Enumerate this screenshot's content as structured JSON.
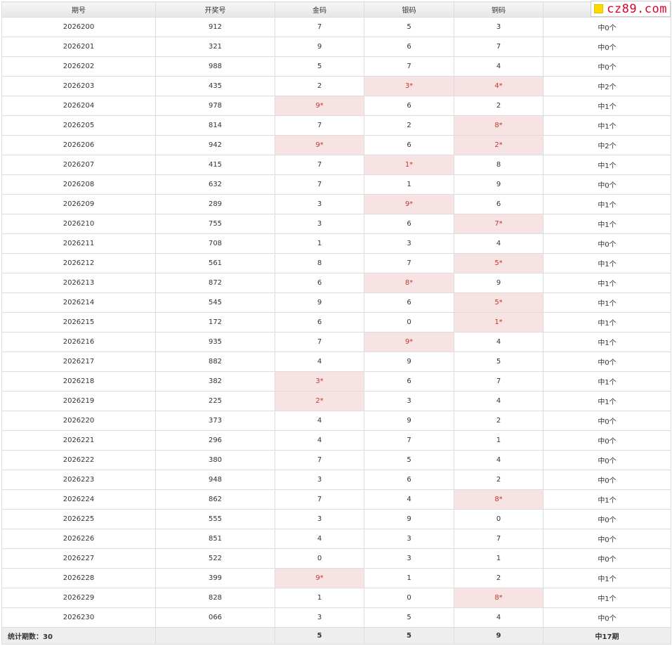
{
  "watermark": "cz89.com",
  "headers": [
    "期号",
    "开奖号",
    "金码",
    "银码",
    "铜码",
    ""
  ],
  "rows": [
    {
      "issue": "2026200",
      "number": "912",
      "gold": "7",
      "silver": "5",
      "bronze": "3",
      "result": "中0个",
      "hits": []
    },
    {
      "issue": "2026201",
      "number": "321",
      "gold": "9",
      "silver": "6",
      "bronze": "7",
      "result": "中0个",
      "hits": []
    },
    {
      "issue": "2026202",
      "number": "988",
      "gold": "5",
      "silver": "7",
      "bronze": "4",
      "result": "中0个",
      "hits": []
    },
    {
      "issue": "2026203",
      "number": "435",
      "gold": "2",
      "silver": "3*",
      "bronze": "4*",
      "result": "中2个",
      "hits": [
        "silver",
        "bronze"
      ]
    },
    {
      "issue": "2026204",
      "number": "978",
      "gold": "9*",
      "silver": "6",
      "bronze": "2",
      "result": "中1个",
      "hits": [
        "gold"
      ]
    },
    {
      "issue": "2026205",
      "number": "814",
      "gold": "7",
      "silver": "2",
      "bronze": "8*",
      "result": "中1个",
      "hits": [
        "bronze"
      ]
    },
    {
      "issue": "2026206",
      "number": "942",
      "gold": "9*",
      "silver": "6",
      "bronze": "2*",
      "result": "中2个",
      "hits": [
        "gold",
        "bronze"
      ]
    },
    {
      "issue": "2026207",
      "number": "415",
      "gold": "7",
      "silver": "1*",
      "bronze": "8",
      "result": "中1个",
      "hits": [
        "silver"
      ]
    },
    {
      "issue": "2026208",
      "number": "632",
      "gold": "7",
      "silver": "1",
      "bronze": "9",
      "result": "中0个",
      "hits": []
    },
    {
      "issue": "2026209",
      "number": "289",
      "gold": "3",
      "silver": "9*",
      "bronze": "6",
      "result": "中1个",
      "hits": [
        "silver"
      ]
    },
    {
      "issue": "2026210",
      "number": "755",
      "gold": "3",
      "silver": "6",
      "bronze": "7*",
      "result": "中1个",
      "hits": [
        "bronze"
      ]
    },
    {
      "issue": "2026211",
      "number": "708",
      "gold": "1",
      "silver": "3",
      "bronze": "4",
      "result": "中0个",
      "hits": []
    },
    {
      "issue": "2026212",
      "number": "561",
      "gold": "8",
      "silver": "7",
      "bronze": "5*",
      "result": "中1个",
      "hits": [
        "bronze"
      ]
    },
    {
      "issue": "2026213",
      "number": "872",
      "gold": "6",
      "silver": "8*",
      "bronze": "9",
      "result": "中1个",
      "hits": [
        "silver"
      ]
    },
    {
      "issue": "2026214",
      "number": "545",
      "gold": "9",
      "silver": "6",
      "bronze": "5*",
      "result": "中1个",
      "hits": [
        "bronze"
      ]
    },
    {
      "issue": "2026215",
      "number": "172",
      "gold": "6",
      "silver": "0",
      "bronze": "1*",
      "result": "中1个",
      "hits": [
        "bronze"
      ]
    },
    {
      "issue": "2026216",
      "number": "935",
      "gold": "7",
      "silver": "9*",
      "bronze": "4",
      "result": "中1个",
      "hits": [
        "silver"
      ]
    },
    {
      "issue": "2026217",
      "number": "882",
      "gold": "4",
      "silver": "9",
      "bronze": "5",
      "result": "中0个",
      "hits": []
    },
    {
      "issue": "2026218",
      "number": "382",
      "gold": "3*",
      "silver": "6",
      "bronze": "7",
      "result": "中1个",
      "hits": [
        "gold"
      ]
    },
    {
      "issue": "2026219",
      "number": "225",
      "gold": "2*",
      "silver": "3",
      "bronze": "4",
      "result": "中1个",
      "hits": [
        "gold"
      ]
    },
    {
      "issue": "2026220",
      "number": "373",
      "gold": "4",
      "silver": "9",
      "bronze": "2",
      "result": "中0个",
      "hits": []
    },
    {
      "issue": "2026221",
      "number": "296",
      "gold": "4",
      "silver": "7",
      "bronze": "1",
      "result": "中0个",
      "hits": []
    },
    {
      "issue": "2026222",
      "number": "380",
      "gold": "7",
      "silver": "5",
      "bronze": "4",
      "result": "中0个",
      "hits": []
    },
    {
      "issue": "2026223",
      "number": "948",
      "gold": "3",
      "silver": "6",
      "bronze": "2",
      "result": "中0个",
      "hits": []
    },
    {
      "issue": "2026224",
      "number": "862",
      "gold": "7",
      "silver": "4",
      "bronze": "8*",
      "result": "中1个",
      "hits": [
        "bronze"
      ]
    },
    {
      "issue": "2026225",
      "number": "555",
      "gold": "3",
      "silver": "9",
      "bronze": "0",
      "result": "中0个",
      "hits": []
    },
    {
      "issue": "2026226",
      "number": "851",
      "gold": "4",
      "silver": "3",
      "bronze": "7",
      "result": "中0个",
      "hits": []
    },
    {
      "issue": "2026227",
      "number": "522",
      "gold": "0",
      "silver": "3",
      "bronze": "1",
      "result": "中0个",
      "hits": []
    },
    {
      "issue": "2026228",
      "number": "399",
      "gold": "9*",
      "silver": "1",
      "bronze": "2",
      "result": "中1个",
      "hits": [
        "gold"
      ]
    },
    {
      "issue": "2026229",
      "number": "828",
      "gold": "1",
      "silver": "0",
      "bronze": "8*",
      "result": "中1个",
      "hits": [
        "bronze"
      ]
    },
    {
      "issue": "2026230",
      "number": "066",
      "gold": "3",
      "silver": "5",
      "bronze": "4",
      "result": "中0个",
      "hits": []
    }
  ],
  "footer": {
    "count_label": "统计期数：30",
    "number": "",
    "gold": "5",
    "silver": "5",
    "bronze": "9",
    "result": "中17期"
  },
  "colors": {
    "hit_bg": "#f8e3e4",
    "hit_text": "#c0392b"
  }
}
